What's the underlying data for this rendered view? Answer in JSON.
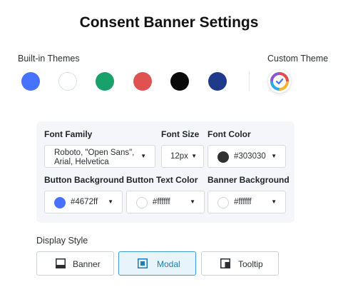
{
  "page": {
    "title": "Consent Banner Settings"
  },
  "themes": {
    "builtin_label": "Built-in Themes",
    "custom_label": "Custom Theme",
    "swatches": [
      {
        "name": "blue",
        "color": "#4672ff"
      },
      {
        "name": "white",
        "color": "#ffffff"
      },
      {
        "name": "green",
        "color": "#1aa06b"
      },
      {
        "name": "red",
        "color": "#e05151"
      },
      {
        "name": "black",
        "color": "#0a0a0a"
      },
      {
        "name": "navy",
        "color": "#1f3a8a"
      }
    ]
  },
  "fields": {
    "font_family": {
      "label": "Font Family",
      "value": "Roboto, \"Open Sans\", Arial, Helvetica"
    },
    "font_size": {
      "label": "Font Size",
      "value": "12px"
    },
    "font_color": {
      "label": "Font Color",
      "value": "#303030",
      "swatch": "#303030"
    },
    "button_background": {
      "label": "Button Background",
      "value": "#4672ff",
      "swatch": "#4672ff"
    },
    "button_text_color": {
      "label": "Button Text Color",
      "value": "#ffffff",
      "swatch": "#ffffff"
    },
    "banner_background": {
      "label": "Banner Background",
      "value": "#ffffff",
      "swatch": "#ffffff"
    }
  },
  "display_style": {
    "label": "Display Style",
    "options": [
      "Banner",
      "Modal",
      "Tooltip"
    ],
    "selected": "Modal"
  }
}
